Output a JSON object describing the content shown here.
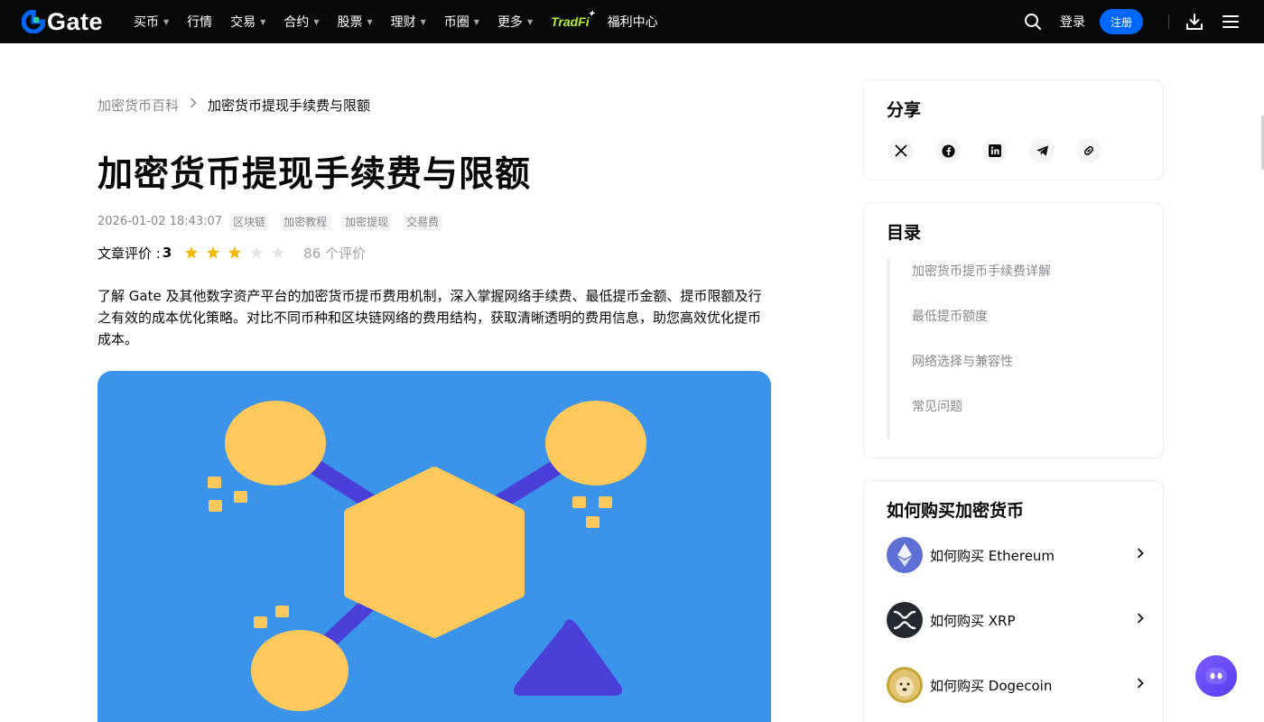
{
  "brand": {
    "name": "Gate"
  },
  "nav": {
    "items": [
      {
        "label": "买币",
        "caret": true
      },
      {
        "label": "行情",
        "caret": false
      },
      {
        "label": "交易",
        "caret": true
      },
      {
        "label": "合约",
        "caret": true
      },
      {
        "label": "股票",
        "caret": true
      },
      {
        "label": "理财",
        "caret": true
      },
      {
        "label": "币圈",
        "caret": true
      },
      {
        "label": "更多",
        "caret": true
      }
    ],
    "tradfi": "TradFi",
    "rewards": "福利中心",
    "login": "登录",
    "register": "注册"
  },
  "breadcrumb": {
    "root": "加密货币百科",
    "current": "加密货币提现手续费与限额"
  },
  "article": {
    "title": "加密货币提现手续费与限额",
    "date": "2026-01-02 18:43:07",
    "tags": [
      "区块链",
      "加密教程",
      "加密提现",
      "交易费"
    ],
    "rating_label": "文章评价 :",
    "rating_score": "3",
    "rating_stars": 3,
    "rating_max": 5,
    "rating_count": "86 个评价",
    "summary": "了解 Gate 及其他数字资产平台的加密货币提币费用机制，深入掌握网络手续费、最低提币金额、提币限额及行之有效的成本优化策略。对比不同币种和区块链网络的费用结构，获取清晰透明的费用信息，助您高效优化提币成本。"
  },
  "share": {
    "title": "分享",
    "icons": [
      "x-icon",
      "facebook-icon",
      "linkedin-icon",
      "telegram-icon",
      "link-icon"
    ]
  },
  "toc": {
    "title": "目录",
    "items": [
      "加密货币提币手续费详解",
      "最低提币额度",
      "网络选择与兼容性",
      "常见问题"
    ]
  },
  "buy": {
    "title": "如何购买加密货币",
    "items": [
      {
        "label": "如何购买 Ethereum",
        "icon": "ethereum-icon"
      },
      {
        "label": "如何购买 XRP",
        "icon": "xrp-icon"
      },
      {
        "label": "如何购买 Dogecoin",
        "icon": "dogecoin-icon"
      }
    ]
  },
  "colors": {
    "nav_bg": "#070808",
    "accent": "#0068ff",
    "star": "#f0b90b",
    "hero_bg": "#3c94ea",
    "hero_shape": "#fdc95c",
    "hero_link": "#4a3fd8"
  }
}
